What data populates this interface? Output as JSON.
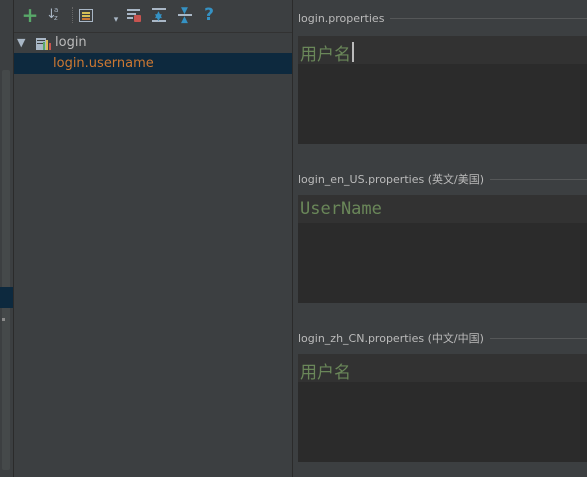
{
  "toolbar": {
    "buttons": [
      {
        "name": "add-icon",
        "glyph": "+",
        "color": "#59a869"
      },
      {
        "name": "sort-alphabetically-icon",
        "glyph": "↓",
        "color": "#a9b7c6"
      },
      {
        "name": "group-by-icon",
        "glyph": "▤",
        "color": "#d6bf55"
      },
      {
        "name": "dropdown-arrow-icon",
        "glyph": "▾",
        "color": "#a9b7c6"
      },
      {
        "name": "filter-icon",
        "glyph": "▦",
        "color": "#a9b7c6"
      },
      {
        "name": "expand-all-icon",
        "glyph": "⇕",
        "color": "#a9b7c6"
      },
      {
        "name": "collapse-all-icon",
        "glyph": "÷",
        "color": "#a9b7c6"
      },
      {
        "name": "help-icon",
        "glyph": "?",
        "color": "#3592c4"
      }
    ],
    "sort_sub": "a z"
  },
  "tree": {
    "root": {
      "label": "login",
      "expanded_glyph": "▼",
      "icon": "resource-bundle-icon"
    },
    "children": [
      {
        "label": "login.username",
        "selected": true,
        "color": "#cc7832"
      }
    ]
  },
  "sections": [
    {
      "title": "login.properties",
      "value": "用户名",
      "caret": true
    },
    {
      "title": "login_en_US.properties (英文/美国)",
      "value": "UserName",
      "caret": false
    },
    {
      "title": "login_zh_CN.properties (中文/中国)",
      "value": "用户名",
      "caret": false
    }
  ],
  "colors": {
    "background": "#3c3f41",
    "editor_bg": "#2b2b2b",
    "value_text": "#6a8759",
    "selection": "#0d293e"
  }
}
